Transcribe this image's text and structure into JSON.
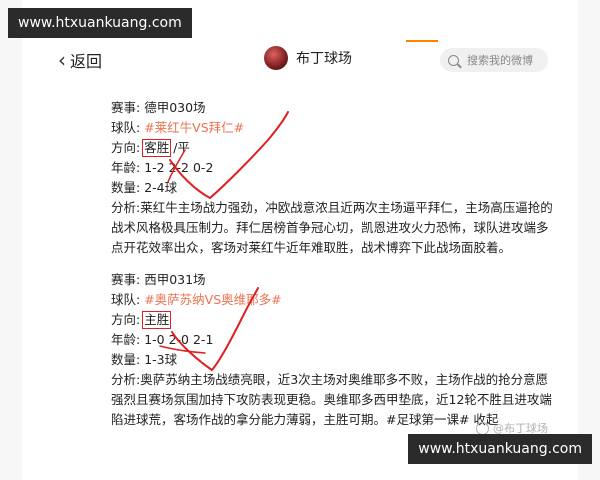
{
  "watermarks": {
    "top": "www.htxuankuang.com",
    "bottom": "www.htxuankuang.com"
  },
  "header": {
    "back_label": "返回",
    "profile_name": "布丁球场",
    "search_placeholder": "搜索我的微博"
  },
  "posts": [
    {
      "event_label": "赛事:",
      "event_value": "德甲030场",
      "teams_label": "球队:",
      "teams_value": "#莱红牛VS拜仁#",
      "direction_label": "方向:",
      "direction_value": "客胜",
      "direction_rest": "/平",
      "age_label": "年龄:",
      "age_value": "1-2 2-2 0-2",
      "count_label": "数量:",
      "count_value": "2-4球",
      "analysis_label": "分析:",
      "analysis_value": "莱红牛主场战力强劲，冲欧战意浓且近两次主场逼平拜仁，主场高压逼抢的战术风格极具压制力。拜仁居榜首争冠心切，凯恩进攻火力恐怖，球队进攻端多点开花效率出众，客场对莱红牛近年难取胜，战术博弈下此战场面胶着。"
    },
    {
      "event_label": "赛事:",
      "event_value": "西甲031场",
      "teams_label": "球队:",
      "teams_value": "#奥萨苏纳VS奥维耶多#",
      "direction_label": "方向:",
      "direction_value": "主胜",
      "direction_rest": "",
      "age_label": "年龄:",
      "age_value": "1-0 2-0 2-1",
      "count_label": "数量:",
      "count_value": "1-3球",
      "analysis_label": "分析:",
      "analysis_value": "奥萨苏纳主场战绩亮眼，近3次主场对奥维耶多不败，主场作战的抢分意愿强烈且赛场氛围加持下攻防表现更稳。奥维耶多西甲垫底，近12轮不胜且进攻端陷进球荒，客场作战的拿分能力薄弱，主胜可期。",
      "hashtags": "#足球第一课# 收起"
    }
  ],
  "weibo_mark": "@布丁球场",
  "colors": {
    "tag": "#eb7350",
    "annotation": "#e02020",
    "accent": "#ff8200"
  }
}
